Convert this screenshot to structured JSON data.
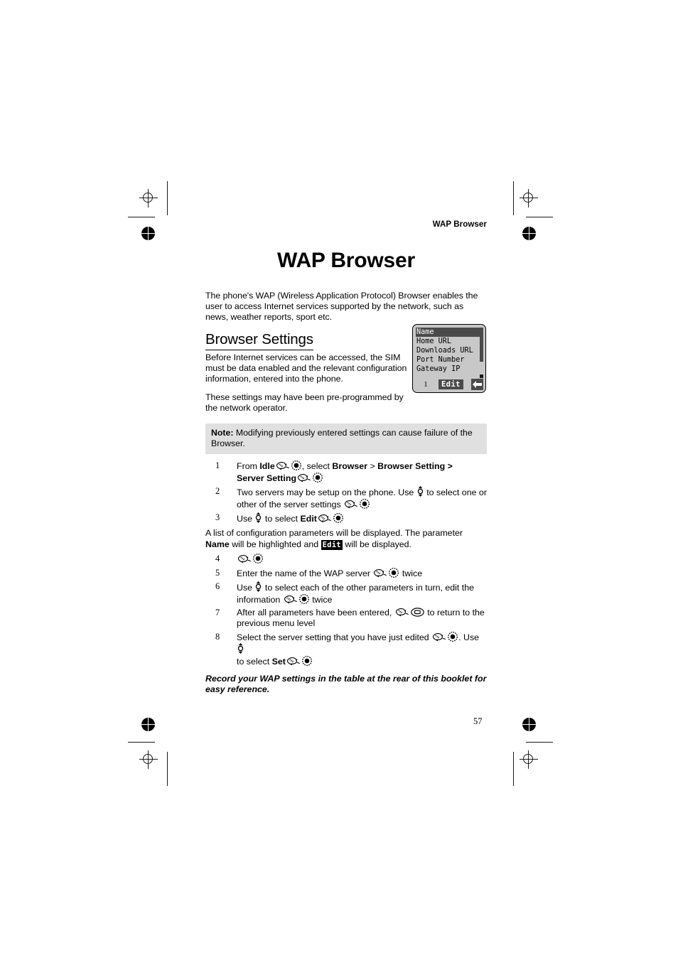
{
  "running_head": "WAP Browser",
  "title": "WAP Browser",
  "intro": "The phone's WAP (Wireless Application Protocol) Browser enables the user to access Internet services supported by the network, such as news, weather reports, sport etc.",
  "section": {
    "heading": "Browser Settings",
    "paragraph_1": "Before Internet services can be accessed, the SIM must be data enabled and the relevant configuration information, entered into the phone.",
    "paragraph_2": "These settings may have been pre-programmed by the network operator."
  },
  "lcd": {
    "rows": [
      "Name",
      "Home URL",
      "Downloads URL",
      "Port Number",
      "Gateway IP"
    ],
    "selected_index": 0,
    "index_label": "1",
    "softkey_label": "Edit",
    "back_icon": "back-arrow-icon",
    "bg_color": "#c8c8c8",
    "highlight_color": "#4a4a4a"
  },
  "note": {
    "label": "Note:",
    "text": "Modifying previously entered settings can cause failure of the Browser."
  },
  "steps": [
    {
      "num": "1",
      "parts": [
        {
          "t": "text",
          "v": "From "
        },
        {
          "t": "bold",
          "v": "Idle"
        },
        {
          "t": "icon",
          "v": "press-hand-icon"
        },
        {
          "t": "icon",
          "v": "select-key-icon"
        },
        {
          "t": "text",
          "v": ", select "
        },
        {
          "t": "bold",
          "v": "Browser"
        },
        {
          "t": "text",
          "v": " > "
        },
        {
          "t": "bold",
          "v": "Browser Setting >"
        },
        {
          "t": "br",
          "v": ""
        },
        {
          "t": "bold",
          "v": "Server Setting"
        },
        {
          "t": "icon",
          "v": "press-hand-icon"
        },
        {
          "t": "icon",
          "v": "select-key-icon"
        }
      ]
    },
    {
      "num": "2",
      "parts": [
        {
          "t": "text",
          "v": "Two servers may be setup on the phone. Use "
        },
        {
          "t": "icon",
          "v": "scroll-updown-icon"
        },
        {
          "t": "text",
          "v": " to select one or other of the server settings "
        },
        {
          "t": "icon",
          "v": "press-hand-icon"
        },
        {
          "t": "icon",
          "v": "select-key-icon"
        }
      ]
    },
    {
      "num": "3",
      "parts": [
        {
          "t": "text",
          "v": "Use "
        },
        {
          "t": "icon",
          "v": "scroll-updown-icon"
        },
        {
          "t": "text",
          "v": " to select "
        },
        {
          "t": "bold",
          "v": "Edit"
        },
        {
          "t": "icon",
          "v": "press-hand-icon"
        },
        {
          "t": "icon",
          "v": "select-key-icon"
        }
      ]
    },
    {
      "num": "4",
      "parts": [
        {
          "t": "icon",
          "v": "press-hand-icon"
        },
        {
          "t": "icon",
          "v": "select-key-icon"
        }
      ]
    },
    {
      "num": "5",
      "parts": [
        {
          "t": "text",
          "v": "Enter the name of the WAP server "
        },
        {
          "t": "icon",
          "v": "press-hand-icon"
        },
        {
          "t": "icon",
          "v": "select-key-icon"
        },
        {
          "t": "text",
          "v": " twice"
        }
      ]
    },
    {
      "num": "6",
      "parts": [
        {
          "t": "text",
          "v": "Use "
        },
        {
          "t": "icon",
          "v": "scroll-updown-icon"
        },
        {
          "t": "text",
          "v": " to select each of the other parameters in turn, edit the information "
        },
        {
          "t": "icon",
          "v": "press-hand-icon"
        },
        {
          "t": "icon",
          "v": "select-key-icon"
        },
        {
          "t": "text",
          "v": " twice"
        }
      ]
    },
    {
      "num": "7",
      "parts": [
        {
          "t": "text",
          "v": "After all parameters have been entered, "
        },
        {
          "t": "icon",
          "v": "press-hand-icon"
        },
        {
          "t": "icon",
          "v": "back-key-icon"
        },
        {
          "t": "text",
          "v": " to return to the previous menu level"
        }
      ]
    },
    {
      "num": "8",
      "parts": [
        {
          "t": "text",
          "v": "Select the server setting that you have just edited "
        },
        {
          "t": "icon",
          "v": "press-hand-icon"
        },
        {
          "t": "icon",
          "v": "select-key-icon"
        },
        {
          "t": "text",
          "v": ". Use "
        },
        {
          "t": "icon",
          "v": "scroll-updown-icon"
        },
        {
          "t": "br",
          "v": ""
        },
        {
          "t": "text",
          "v": "to select "
        },
        {
          "t": "bold",
          "v": "Set"
        },
        {
          "t": "icon",
          "v": "press-hand-icon"
        },
        {
          "t": "icon",
          "v": "select-key-icon"
        }
      ]
    }
  ],
  "interstitial": {
    "before": "A list of configuration parameters will be displayed. The parameter ",
    "bold_1": "Name",
    "middle": " will be highlighted and ",
    "badge": "Edit",
    "after": " will be displayed."
  },
  "closing": "Record your WAP settings in the table at the rear of this booklet for easy reference.",
  "page_number": "57"
}
